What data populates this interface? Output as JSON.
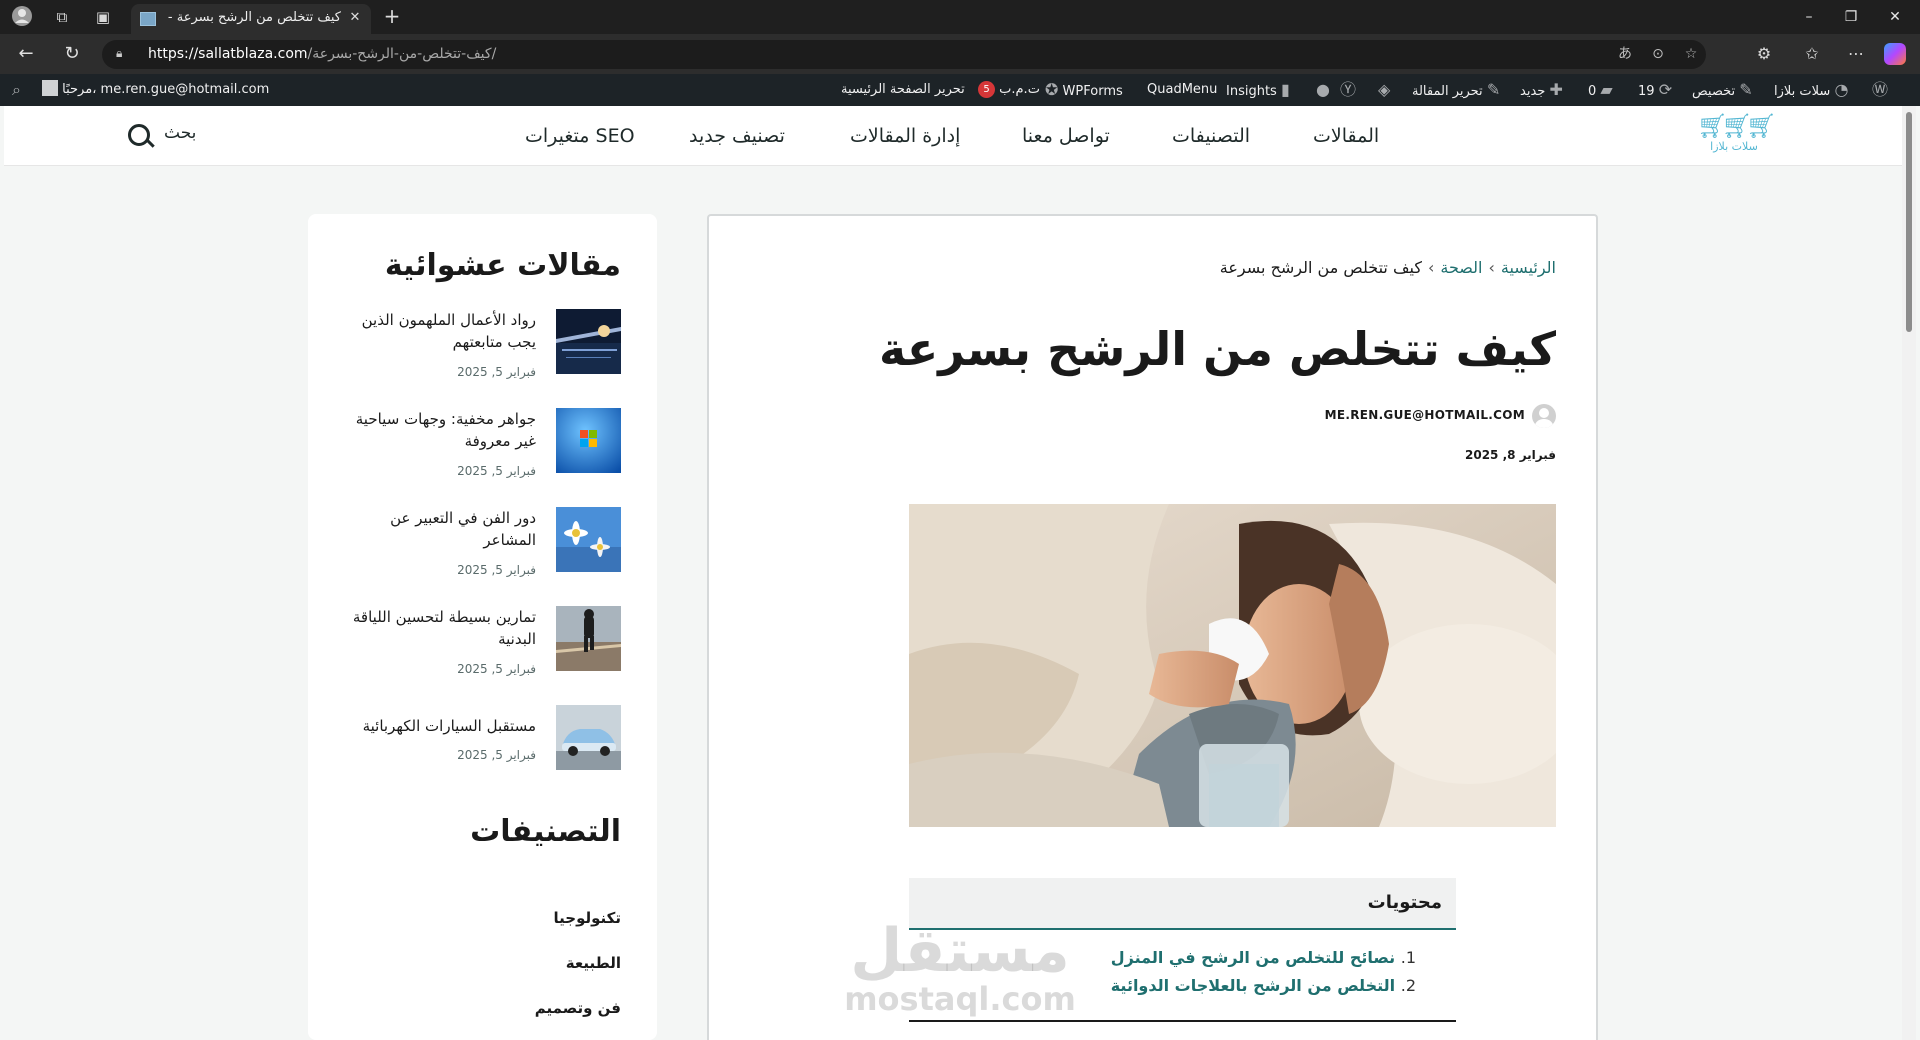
{
  "browser": {
    "tab_title": "كيف تتخلص من الرشح بسرعة - سلا",
    "tab_close": "✕",
    "new_tab": "+",
    "url_host": "https://sallatblaza.com",
    "url_path": "/كيف-تتخلص-من-الرشح-بسرعة/",
    "window_min": "–",
    "window_max": "❐",
    "window_close": "✕"
  },
  "adminbar": {
    "site_name": "سلات بلازا",
    "customize": "تخصيص",
    "updates": "19",
    "comments": "0",
    "new": "جديد",
    "edit_post": "تحرير المقالة",
    "insights": "Insights",
    "quadmenu": "QuadMenu",
    "wpforms": "WPForms",
    "seo_label": "ت.م.ب",
    "seo_badge": "5",
    "edit_homepage": "تحرير الصفحة الرئيسية",
    "greeting": "مرحبًا، me.ren.gue@hotmail.com"
  },
  "header": {
    "logo_text": "سلات بلازا",
    "nav": [
      "المقالات",
      "التصنيفات",
      "تواصل معنا",
      "إدارة المقالات",
      "تصنيف جديد",
      "متغيرات SEO"
    ],
    "search_label": "بحث"
  },
  "sidebar": {
    "random_title": "مقالات عشوائية",
    "posts": [
      {
        "title": "رواد الأعمال الملهمون الذين يجب متابعتهم",
        "date": "فبراير 5, 2025"
      },
      {
        "title": "جواهر مخفية: وجهات سياحية غير معروفة",
        "date": "فبراير 5, 2025"
      },
      {
        "title": "دور الفن في التعبير عن المشاعر",
        "date": "فبراير 5, 2025"
      },
      {
        "title": "تمارين بسيطة لتحسين اللياقة البدنية",
        "date": "فبراير 5, 2025"
      },
      {
        "title": "مستقبل السيارات الكهربائية",
        "date": "فبراير 5, 2025"
      }
    ],
    "categories_title": "التصنيفات",
    "categories": [
      "تكنولوجيا",
      "الطبيعة",
      "فن وتصميم"
    ]
  },
  "article": {
    "breadcrumb": [
      "الرئيسية",
      "الصحة",
      "كيف تتخلص من الرشح بسرعة"
    ],
    "breadcrumb_sep": "›",
    "title": "كيف تتخلص من الرشح بسرعة",
    "author": "ME.REN.GUE@HOTMAIL.COM",
    "date": "فبراير 8, 2025",
    "toc_title": "محتويات",
    "toc": [
      {
        "num": "1.",
        "text": "نصائح للتخلص من الرشح في المنزل"
      },
      {
        "num": "2.",
        "text": "التخلص من الرشح بالعلاجات الدوائية"
      }
    ]
  },
  "watermark": {
    "line1": "مستقل",
    "line2": "mostaql.com"
  }
}
